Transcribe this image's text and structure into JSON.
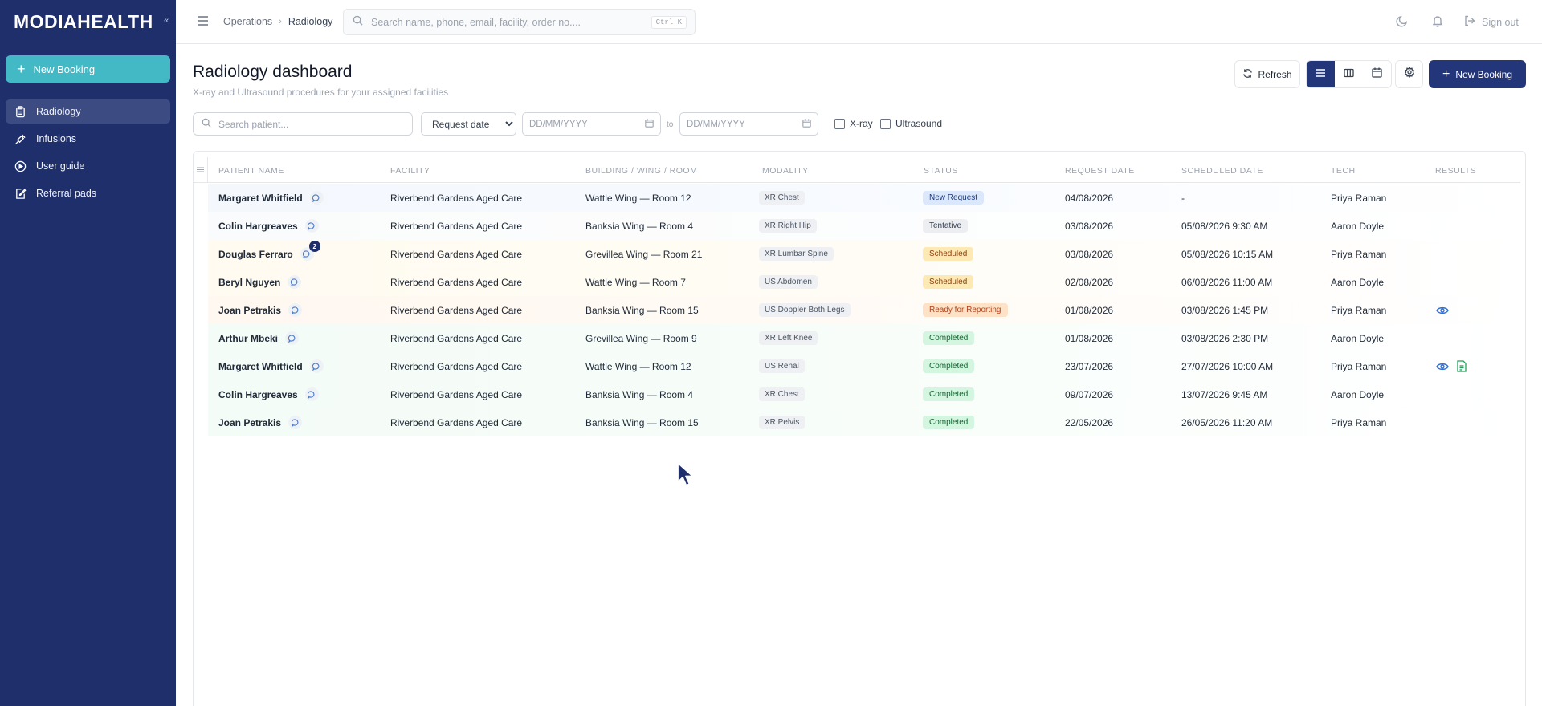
{
  "app": {
    "brand": "MODIAHEALTH",
    "collapse_glyph": "«"
  },
  "sidebar": {
    "new_booking_label": "New Booking",
    "items": [
      {
        "label": "Radiology",
        "icon": "clipboard-icon",
        "active": true
      },
      {
        "label": "Infusions",
        "icon": "syringe-icon",
        "active": false
      },
      {
        "label": "User guide",
        "icon": "play-circle-icon",
        "active": false
      },
      {
        "label": "Referral pads",
        "icon": "pad-edit-icon",
        "active": false
      }
    ]
  },
  "header": {
    "breadcrumb": [
      "Operations",
      "Radiology"
    ],
    "search_placeholder": "Search name, phone, email, facility, order no....",
    "search_shortcut": "Ctrl K",
    "signout_label": "Sign out",
    "icons": [
      "menu-icon",
      "moon-icon",
      "bell-icon",
      "sign-out-icon"
    ]
  },
  "page": {
    "title": "Radiology dashboard",
    "subtitle": "X-ray and Ultrasound procedures for your assigned facilities",
    "refresh_label": "Refresh",
    "new_booking_label": "New Booking",
    "view_modes": [
      "list-view-icon",
      "columns-view-icon",
      "calendar-view-icon"
    ],
    "active_view": "list-view-icon"
  },
  "filters": {
    "patient_search_placeholder": "Search patient...",
    "date_type_selected": "Request date",
    "date_from_placeholder": "DD/MM/YYYY",
    "to_label": "to",
    "date_to_placeholder": "DD/MM/YYYY",
    "xray_label": "X-ray",
    "ultrasound_label": "Ultrasound"
  },
  "table": {
    "columns": [
      "Patient Name",
      "Facility",
      "Building / Wing / Room",
      "Modality",
      "Status",
      "Request Date",
      "Scheduled Date",
      "Tech",
      "Results"
    ],
    "rows": [
      {
        "patient": "Margaret Whitfield",
        "comments": "",
        "facility": "Riverbend Gardens Aged Care",
        "room": "Wattle Wing — Room 12",
        "modality": "XR Chest",
        "status": "New Request",
        "status_kind": "new",
        "request_date": "04/08/2026",
        "scheduled_date": "-",
        "tech": "Priya Raman",
        "results": []
      },
      {
        "patient": "Colin Hargreaves",
        "comments": "",
        "facility": "Riverbend Gardens Aged Care",
        "room": "Banksia Wing — Room 4",
        "modality": "XR Right Hip",
        "status": "Tentative",
        "status_kind": "ten",
        "request_date": "03/08/2026",
        "scheduled_date": "05/08/2026 9:30 AM",
        "tech": "Aaron Doyle",
        "results": []
      },
      {
        "patient": "Douglas Ferraro",
        "comments": "2",
        "facility": "Riverbend Gardens Aged Care",
        "room": "Grevillea Wing — Room 21",
        "modality": "XR Lumbar Spine",
        "status": "Scheduled",
        "status_kind": "sch",
        "request_date": "03/08/2026",
        "scheduled_date": "05/08/2026 10:15 AM",
        "tech": "Priya Raman",
        "results": []
      },
      {
        "patient": "Beryl Nguyen",
        "comments": "",
        "facility": "Riverbend Gardens Aged Care",
        "room": "Wattle Wing — Room 7",
        "modality": "US Abdomen",
        "status": "Scheduled",
        "status_kind": "sch",
        "request_date": "02/08/2026",
        "scheduled_date": "06/08/2026 11:00 AM",
        "tech": "Aaron Doyle",
        "results": []
      },
      {
        "patient": "Joan Petrakis",
        "comments": "",
        "facility": "Riverbend Gardens Aged Care",
        "room": "Banksia Wing — Room 15",
        "modality": "US Doppler Both Legs",
        "status": "Ready for Reporting",
        "status_kind": "rep",
        "request_date": "01/08/2026",
        "scheduled_date": "03/08/2026 1:45 PM",
        "tech": "Priya Raman",
        "results": [
          "eye-icon"
        ]
      },
      {
        "patient": "Arthur Mbeki",
        "comments": "",
        "facility": "Riverbend Gardens Aged Care",
        "room": "Grevillea Wing — Room 9",
        "modality": "XR Left Knee",
        "status": "Completed",
        "status_kind": "com",
        "request_date": "01/08/2026",
        "scheduled_date": "03/08/2026 2:30 PM",
        "tech": "Aaron Doyle",
        "results": []
      },
      {
        "patient": "Margaret Whitfield",
        "comments": "",
        "facility": "Riverbend Gardens Aged Care",
        "room": "Wattle Wing — Room 12",
        "modality": "US Renal",
        "status": "Completed",
        "status_kind": "com",
        "request_date": "23/07/2026",
        "scheduled_date": "27/07/2026 10:00 AM",
        "tech": "Priya Raman",
        "results": [
          "eye-icon",
          "document-icon"
        ]
      },
      {
        "patient": "Colin Hargreaves",
        "comments": "",
        "facility": "Riverbend Gardens Aged Care",
        "room": "Banksia Wing — Room 4",
        "modality": "XR Chest",
        "status": "Completed",
        "status_kind": "com",
        "request_date": "09/07/2026",
        "scheduled_date": "13/07/2026 9:45 AM",
        "tech": "Aaron Doyle",
        "results": []
      },
      {
        "patient": "Joan Petrakis",
        "comments": "",
        "facility": "Riverbend Gardens Aged Care",
        "room": "Banksia Wing — Room 15",
        "modality": "XR Pelvis",
        "status": "Completed",
        "status_kind": "com",
        "request_date": "22/05/2026",
        "scheduled_date": "26/05/2026 11:20 AM",
        "tech": "Priya Raman",
        "results": []
      }
    ]
  },
  "colors": {
    "sidebar_bg": "#1e2f6b",
    "accent_teal": "#43b9c6",
    "primary": "#24367a"
  }
}
